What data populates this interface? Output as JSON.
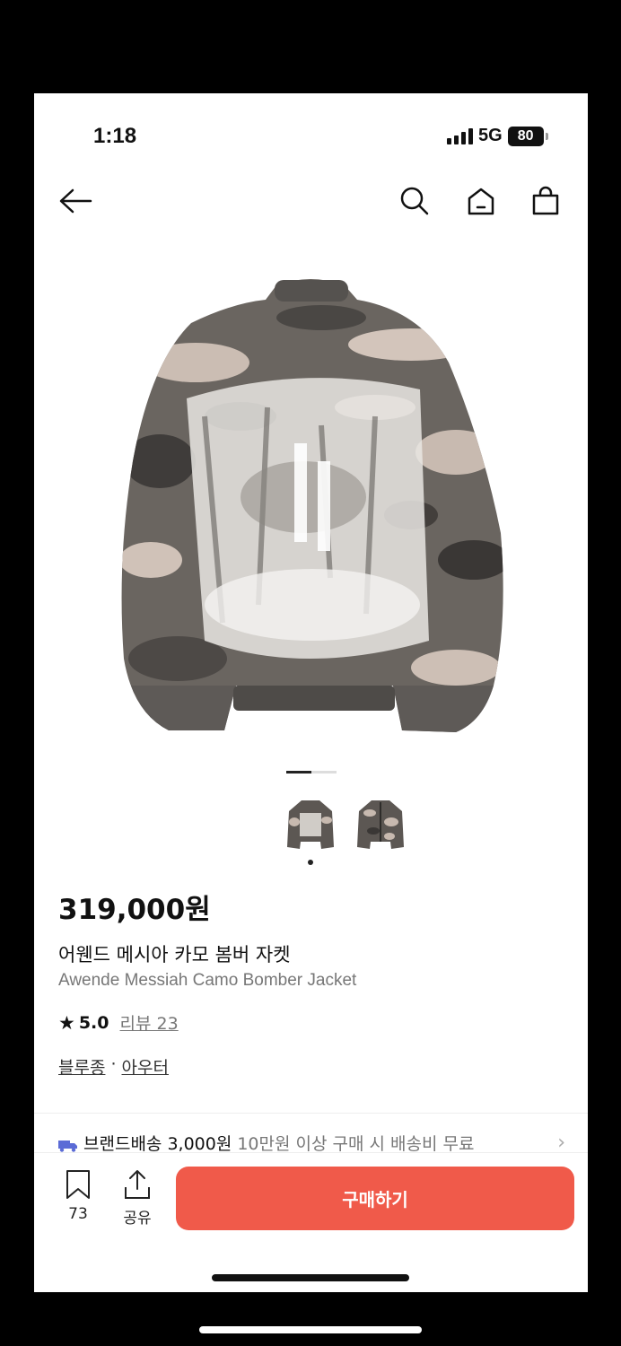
{
  "status": {
    "time": "1:18",
    "network": "5G",
    "battery": "80"
  },
  "nav": {
    "back_icon": "arrow-left-icon",
    "search_icon": "search-icon",
    "home_icon": "home-icon",
    "bag_icon": "shopping-bag-icon"
  },
  "gallery": {
    "current_index": 1,
    "total": 2
  },
  "product": {
    "price": "319,000원",
    "name_ko": "어웬드 메시아 카모 봄버 자켓",
    "name_en": "Awende Messiah Camo Bomber Jacket",
    "rating": "5.0",
    "reviews": "리뷰 23",
    "category_1": "블루종",
    "separator": "·",
    "category_2": "아우터"
  },
  "shipping": {
    "label": "브랜드배송 3,000원",
    "note": "10만원 이상 구매 시 배송비 무료"
  },
  "bottom": {
    "bookmark_count": "73",
    "share_label": "공유",
    "buy_label": "구매하기"
  },
  "colors": {
    "accent": "#f05a4a"
  }
}
